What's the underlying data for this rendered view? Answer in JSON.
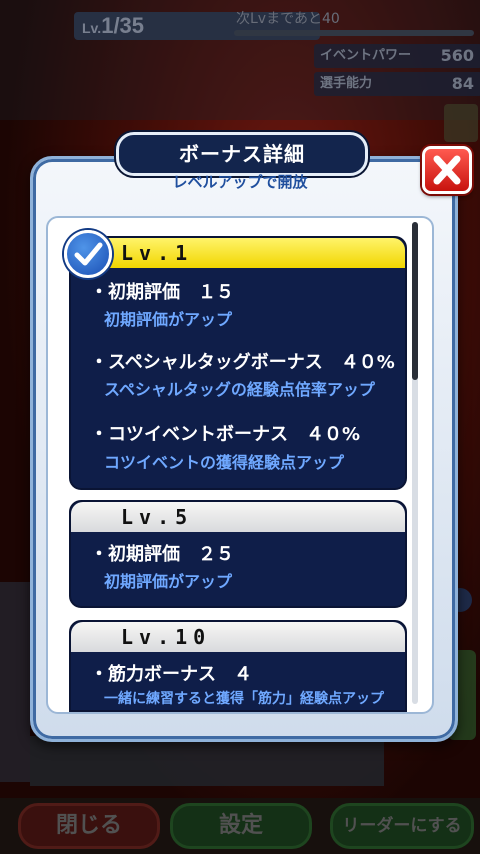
{
  "background": {
    "level_label": "Lv.",
    "level_value": "1/35",
    "next_level_text": "次Lvまであと40",
    "stats": [
      {
        "label": "イベントパワー",
        "value": "560"
      },
      {
        "label": "選手能力",
        "value": "84"
      }
    ],
    "buttons": {
      "close": "閉じる",
      "settings": "設定",
      "leader": "リーダーにする"
    }
  },
  "modal": {
    "title": "ボーナス詳細",
    "subtitle": "レベルアップで開放"
  },
  "cards": [
    {
      "level": "Lv.1",
      "unlocked": true,
      "bonuses": [
        {
          "title": "・初期評価　１５",
          "description": "初期評価がアップ"
        },
        {
          "title": "・スペシャルタッグボーナス　４０%",
          "description": "スペシャルタッグの経験点倍率アップ"
        },
        {
          "title": "・コツイベントボーナス　４０%",
          "description": "コツイベントの獲得経験点アップ"
        }
      ]
    },
    {
      "level": "Lv.5",
      "unlocked": false,
      "bonuses": [
        {
          "title": "・初期評価　２５",
          "description": "初期評価がアップ"
        }
      ]
    },
    {
      "level": "Lv.10",
      "unlocked": false,
      "bonuses": [
        {
          "title": "・筋力ボーナス　４",
          "description": "一緒に練習すると獲得「筋力」経験点アップ"
        }
      ]
    }
  ],
  "icons": {
    "close": "close-x-icon",
    "check": "checkmark-icon"
  },
  "colors": {
    "card_bg": "#0f1e49",
    "unlocked_header": "#f1d600",
    "description_text": "#6fa8ff",
    "close_button": "#c8130e"
  }
}
